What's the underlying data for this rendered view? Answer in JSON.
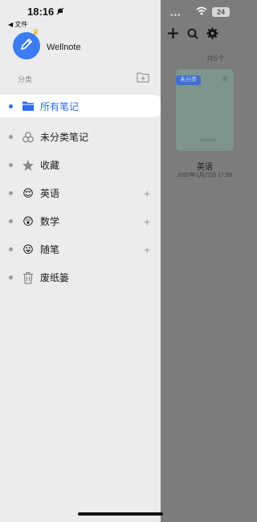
{
  "status": {
    "time": "18:16",
    "back_label": "◀ 文件",
    "battery": "24"
  },
  "app": {
    "name": "Wellnote"
  },
  "sidebar": {
    "section_label": "分类",
    "items": [
      {
        "label": "所有笔记",
        "active": true,
        "icon": "folder-icon",
        "has_add": false
      },
      {
        "label": "未分类笔记",
        "icon": "circles-icon",
        "has_add": false
      },
      {
        "label": "收藏",
        "icon": "star-icon",
        "has_add": false
      },
      {
        "label": "英语",
        "icon": "relieved-face-emoji",
        "emoji": "😌",
        "has_add": true
      },
      {
        "label": "数学",
        "icon": "hushed-face-emoji",
        "emoji": "😲",
        "has_add": true
      },
      {
        "label": "随笔",
        "icon": "tongue-face-emoji",
        "emoji": "😛",
        "has_add": true
      },
      {
        "label": "废纸篓",
        "icon": "trash-icon",
        "has_add": false
      }
    ]
  },
  "background": {
    "count_label": "共5个",
    "notebook": {
      "badge": "未分类",
      "title": "英语",
      "date": "2025年1月22日 17:53",
      "cover_logo": "Wellnote"
    }
  },
  "colors": {
    "accent": "#2e6cf0",
    "drawer_bg": "#ececee",
    "overlay": "#7c7c7c"
  }
}
